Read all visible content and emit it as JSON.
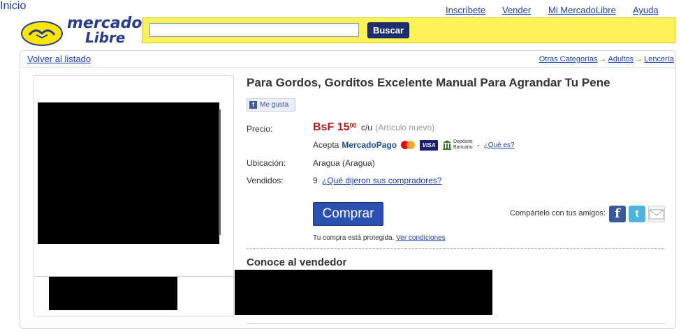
{
  "topnav": {
    "home": "Inicio",
    "register": "Inscríbete",
    "sell": "Vender",
    "my_account": "Mi MercadoLibre",
    "help": "Ayuda"
  },
  "logo": {
    "line1": "mercado",
    "line2": "Libre"
  },
  "search": {
    "value": "",
    "placeholder": "",
    "button_label": "Buscar"
  },
  "nav": {
    "back_label": "Volver al listado",
    "breadcrumb": [
      "Otras Categorías",
      "Adultos",
      "Lencería"
    ],
    "breadcrumb_sep": "→"
  },
  "product": {
    "title": "Para Gordos, Gorditos Excelente Manual Para Agrandar Tu Pene",
    "like_label": "Me gusta",
    "price_label": "Precio:",
    "currency": "BsF",
    "price_int": "15",
    "price_cents": "00",
    "price_unit": "c/u",
    "condition": "(Artículo nuevo)",
    "accept_prefix": "Acepta",
    "payment_brand": "MercadoPago",
    "visa_label": "VISA",
    "bank_label_1": "Depósito",
    "bank_label_2": "Bancario",
    "accept_sep": "-",
    "what_is": "¿Qué es?",
    "location_label": "Ubicación:",
    "location": "Aragua (Aragua)",
    "sold_label": "Vendidos:",
    "sold_count": "9",
    "reviews_link": "¿Qué dijeron sus compradores?",
    "buy_label": "Comprar",
    "share_label": "Compártelo con tus amigos:",
    "protected_text": "Tu compra está protegida.",
    "conditions_link": "Ver condiciones",
    "seller_heading": "Conoce al vendedor"
  },
  "colors": {
    "yellow_bar": "#fff159",
    "price_red": "#b81a1a",
    "link_blue": "#1a3fa8",
    "buy_blue": "#2b50b2"
  },
  "icons": {
    "facebook": "facebook-icon",
    "twitter": "twitter-icon",
    "email": "email-icon",
    "mastercard": "mastercard-icon",
    "visa": "visa-icon",
    "bank": "bank-icon"
  }
}
